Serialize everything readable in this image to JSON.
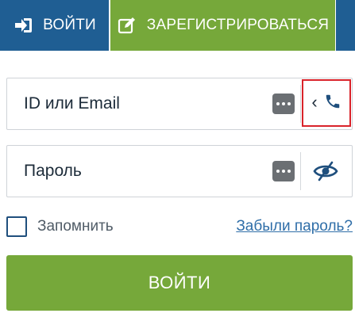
{
  "tabs": {
    "login": {
      "label": "ВОЙТИ",
      "icon": "sign-in-icon"
    },
    "register": {
      "label": "ЗАРЕГИСТРИРОВАТЬСЯ",
      "icon": "edit-icon"
    }
  },
  "form": {
    "login_field": {
      "placeholder": "ID или Email",
      "switch_icon": "phone-icon"
    },
    "password_field": {
      "placeholder": "Пароль",
      "toggle_icon": "eye-slash-icon"
    },
    "remember_label": "Запомнить",
    "remember_checked": false,
    "forgot_link": "Забыли пароль?",
    "submit_label": "ВОЙТИ"
  },
  "colors": {
    "primary_blue": "#1f5e93",
    "accent_green": "#76a83a",
    "highlight_red": "#d9232a",
    "link_blue": "#2f6ea8"
  }
}
